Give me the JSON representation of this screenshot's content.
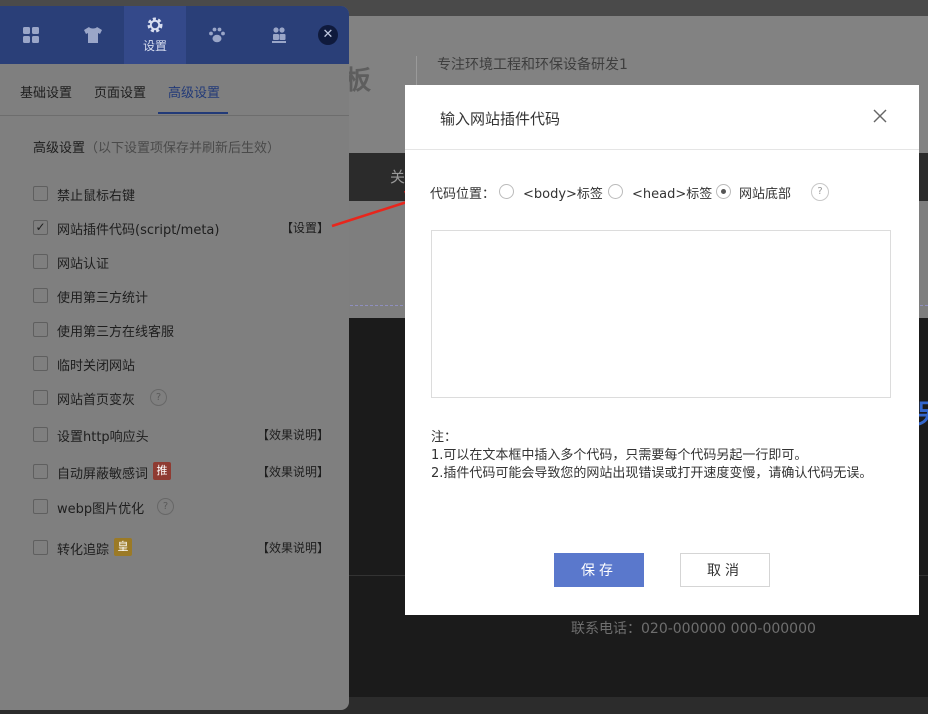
{
  "background_site": {
    "logo_fragment": "板",
    "slogan": "专注环境工程和环保设备研发1",
    "nav_fragment": "关",
    "contact": "联系电话：020-000000    000-000000",
    "blue_fragment": "另"
  },
  "panel": {
    "top_tabs": [
      {
        "icon": "grid-icon",
        "label": ""
      },
      {
        "icon": "shirt-icon",
        "label": ""
      },
      {
        "icon": "gear-icon",
        "label": "设置"
      },
      {
        "icon": "paw-icon",
        "label": ""
      },
      {
        "icon": "people-icon",
        "label": ""
      }
    ],
    "close_glyph": "✕",
    "sub_tabs": [
      "基础设置",
      "页面设置",
      "高级设置"
    ],
    "active_sub_tab": "高级设置",
    "section_title": "高级设置",
    "section_hint": "（以下设置项保存并刷新后生效）",
    "options": [
      {
        "label": "禁止鼠标右键",
        "checked": false
      },
      {
        "label": "网站插件代码(script/meta)",
        "checked": true,
        "link": "【设置】"
      },
      {
        "label": "网站认证",
        "checked": false
      },
      {
        "label": "使用第三方统计",
        "checked": false
      },
      {
        "label": "使用第三方在线客服",
        "checked": false
      },
      {
        "label": "临时关闭网站",
        "checked": false
      },
      {
        "label": "网站首页变灰",
        "checked": false,
        "help": "?"
      },
      {
        "label": "设置http响应头",
        "checked": false,
        "link": "【效果说明】"
      },
      {
        "label": "自动屏蔽敏感词",
        "checked": false,
        "tag": "推",
        "link": "【效果说明】"
      },
      {
        "label": "webp图片优化",
        "checked": false,
        "help": "?"
      },
      {
        "label": "转化追踪",
        "checked": false,
        "tag": "皇",
        "link": "【效果说明】"
      }
    ],
    "check_glyph": "✓"
  },
  "dialog": {
    "title": "输入网站插件代码",
    "position_label": "代码位置：",
    "positions": [
      {
        "label": "<body>标签",
        "checked": false
      },
      {
        "label": "<head>标签",
        "checked": false
      },
      {
        "label": "网站底部",
        "checked": true
      }
    ],
    "help": "?",
    "code_value": "",
    "notes_title": "注：",
    "notes": [
      "1.可以在文本框中插入多个代码，只需要每个代码另起一行即可。",
      "2.插件代码可能会导致您的网站出现错误或打开速度变慢，请确认代码无误。"
    ],
    "save_label": "保存",
    "cancel_label": "取消"
  },
  "colors": {
    "panel_header": "#2a3f78",
    "active_tab": "#223a78",
    "save_button": "#5a78cc",
    "arrow": "#e8261c"
  }
}
